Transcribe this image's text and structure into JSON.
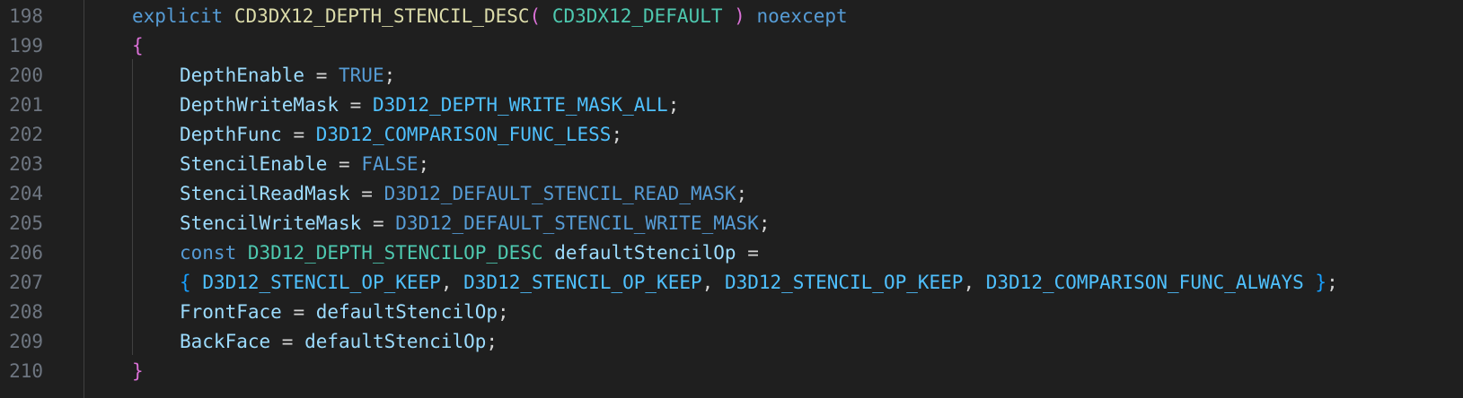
{
  "editor": {
    "lines": [
      {
        "number": "198",
        "indent": 1,
        "tokens": [
          {
            "text": "explicit",
            "kind": "keyword"
          },
          {
            "text": " ",
            "kind": "punc"
          },
          {
            "text": "CD3DX12_DEPTH_STENCIL_DESC",
            "kind": "func"
          },
          {
            "text": "(",
            "kind": "paren"
          },
          {
            "text": " ",
            "kind": "punc"
          },
          {
            "text": "CD3DX12_DEFAULT",
            "kind": "type"
          },
          {
            "text": " ",
            "kind": "punc"
          },
          {
            "text": ")",
            "kind": "paren"
          },
          {
            "text": " ",
            "kind": "punc"
          },
          {
            "text": "noexcept",
            "kind": "keyword"
          }
        ]
      },
      {
        "number": "199",
        "indent": 1,
        "tokens": [
          {
            "text": "{",
            "kind": "brace"
          }
        ]
      },
      {
        "number": "200",
        "indent": 2,
        "tokens": [
          {
            "text": "DepthEnable",
            "kind": "field"
          },
          {
            "text": " = ",
            "kind": "punc"
          },
          {
            "text": "TRUE",
            "kind": "keyword"
          },
          {
            "text": ";",
            "kind": "punc"
          }
        ]
      },
      {
        "number": "201",
        "indent": 2,
        "tokens": [
          {
            "text": "DepthWriteMask",
            "kind": "field"
          },
          {
            "text": " = ",
            "kind": "punc"
          },
          {
            "text": "D3D12_DEPTH_WRITE_MASK_ALL",
            "kind": "macro"
          },
          {
            "text": ";",
            "kind": "punc"
          }
        ]
      },
      {
        "number": "202",
        "indent": 2,
        "tokens": [
          {
            "text": "DepthFunc",
            "kind": "field"
          },
          {
            "text": " = ",
            "kind": "punc"
          },
          {
            "text": "D3D12_COMPARISON_FUNC_LESS",
            "kind": "macro"
          },
          {
            "text": ";",
            "kind": "punc"
          }
        ]
      },
      {
        "number": "203",
        "indent": 2,
        "tokens": [
          {
            "text": "StencilEnable",
            "kind": "field"
          },
          {
            "text": " = ",
            "kind": "punc"
          },
          {
            "text": "FALSE",
            "kind": "keyword"
          },
          {
            "text": ";",
            "kind": "punc"
          }
        ]
      },
      {
        "number": "204",
        "indent": 2,
        "tokens": [
          {
            "text": "StencilReadMask",
            "kind": "field"
          },
          {
            "text": " = ",
            "kind": "punc"
          },
          {
            "text": "D3D12_DEFAULT_STENCIL_READ_MASK",
            "kind": "keyword"
          },
          {
            "text": ";",
            "kind": "punc"
          }
        ]
      },
      {
        "number": "205",
        "indent": 2,
        "tokens": [
          {
            "text": "StencilWriteMask",
            "kind": "field"
          },
          {
            "text": " = ",
            "kind": "punc"
          },
          {
            "text": "D3D12_DEFAULT_STENCIL_WRITE_MASK",
            "kind": "keyword"
          },
          {
            "text": ";",
            "kind": "punc"
          }
        ]
      },
      {
        "number": "206",
        "indent": 2,
        "tokens": [
          {
            "text": "const",
            "kind": "keyword"
          },
          {
            "text": " ",
            "kind": "punc"
          },
          {
            "text": "D3D12_DEPTH_STENCILOP_DESC",
            "kind": "type"
          },
          {
            "text": " ",
            "kind": "punc"
          },
          {
            "text": "defaultStencilOp",
            "kind": "var"
          },
          {
            "text": " =",
            "kind": "punc"
          }
        ]
      },
      {
        "number": "207",
        "indent": 2,
        "tokens": [
          {
            "text": "{",
            "kind": "brace2"
          },
          {
            "text": " ",
            "kind": "punc"
          },
          {
            "text": "D3D12_STENCIL_OP_KEEP",
            "kind": "macro"
          },
          {
            "text": ", ",
            "kind": "punc"
          },
          {
            "text": "D3D12_STENCIL_OP_KEEP",
            "kind": "macro"
          },
          {
            "text": ", ",
            "kind": "punc"
          },
          {
            "text": "D3D12_STENCIL_OP_KEEP",
            "kind": "macro"
          },
          {
            "text": ", ",
            "kind": "punc"
          },
          {
            "text": "D3D12_COMPARISON_FUNC_ALWAYS",
            "kind": "macro"
          },
          {
            "text": " ",
            "kind": "punc"
          },
          {
            "text": "}",
            "kind": "brace2"
          },
          {
            "text": ";",
            "kind": "punc"
          }
        ]
      },
      {
        "number": "208",
        "indent": 2,
        "tokens": [
          {
            "text": "FrontFace",
            "kind": "field"
          },
          {
            "text": " = ",
            "kind": "punc"
          },
          {
            "text": "defaultStencilOp",
            "kind": "var"
          },
          {
            "text": ";",
            "kind": "punc"
          }
        ]
      },
      {
        "number": "209",
        "indent": 2,
        "tokens": [
          {
            "text": "BackFace",
            "kind": "field"
          },
          {
            "text": " = ",
            "kind": "punc"
          },
          {
            "text": "defaultStencilOp",
            "kind": "var"
          },
          {
            "text": ";",
            "kind": "punc"
          }
        ]
      },
      {
        "number": "210",
        "indent": 1,
        "tokens": [
          {
            "text": "}",
            "kind": "brace"
          }
        ]
      }
    ]
  },
  "colors": {
    "background": "#1f1f1f",
    "line_number": "#6e7681",
    "keyword": "#569cd6",
    "type": "#4ec9b0",
    "function": "#dcdcaa",
    "field": "#9cdcfe",
    "macro": "#4fc1ff",
    "bracket_level_1": "#da70d6",
    "bracket_level_2": "#179fff"
  }
}
